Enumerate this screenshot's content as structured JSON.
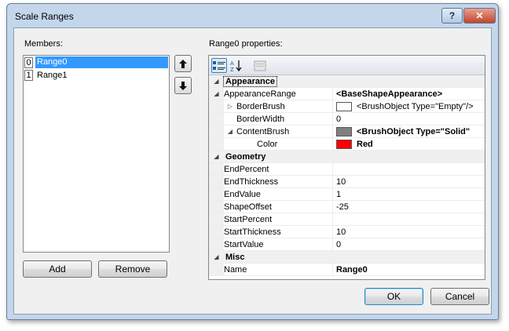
{
  "window": {
    "title": "Scale Ranges",
    "help_label": "?",
    "close_label": "✕"
  },
  "members": {
    "label": "Members:",
    "items": [
      {
        "index": "0",
        "name": "Range0"
      },
      {
        "index": "1",
        "name": "Range1"
      }
    ],
    "add_label": "Add",
    "remove_label": "Remove"
  },
  "properties": {
    "label": "Range0 properties:",
    "categories": {
      "appearance": "Appearance",
      "geometry": "Geometry",
      "misc": "Misc"
    },
    "rows": {
      "appearance_range": {
        "name": "AppearanceRange",
        "value": "<BaseShapeAppearance>"
      },
      "border_brush": {
        "name": "BorderBrush",
        "value": "<BrushObject Type=\"Empty\"/>",
        "swatch": "#ffffff"
      },
      "border_width": {
        "name": "BorderWidth",
        "value": "0"
      },
      "content_brush": {
        "name": "ContentBrush",
        "value": "<BrushObject Type=\"Solid\"",
        "swatch": "#808080"
      },
      "color": {
        "name": "Color",
        "value": "Red",
        "swatch": "#ff0000"
      },
      "end_percent": {
        "name": "EndPercent",
        "value": ""
      },
      "end_thickness": {
        "name": "EndThickness",
        "value": "10"
      },
      "end_value": {
        "name": "EndValue",
        "value": "1"
      },
      "shape_offset": {
        "name": "ShapeOffset",
        "value": "-25"
      },
      "start_percent": {
        "name": "StartPercent",
        "value": ""
      },
      "start_thickness": {
        "name": "StartThickness",
        "value": "10"
      },
      "start_value": {
        "name": "StartValue",
        "value": "0"
      },
      "name": {
        "name": "Name",
        "value": "Range0"
      }
    }
  },
  "footer": {
    "ok_label": "OK",
    "cancel_label": "Cancel"
  },
  "icons": {
    "move_up": "arrow-up-icon",
    "move_down": "arrow-down-icon",
    "categorized": "categorized-icon",
    "alphabetical": "sort-alphabetical-icon",
    "property_pages": "property-pages-icon"
  }
}
